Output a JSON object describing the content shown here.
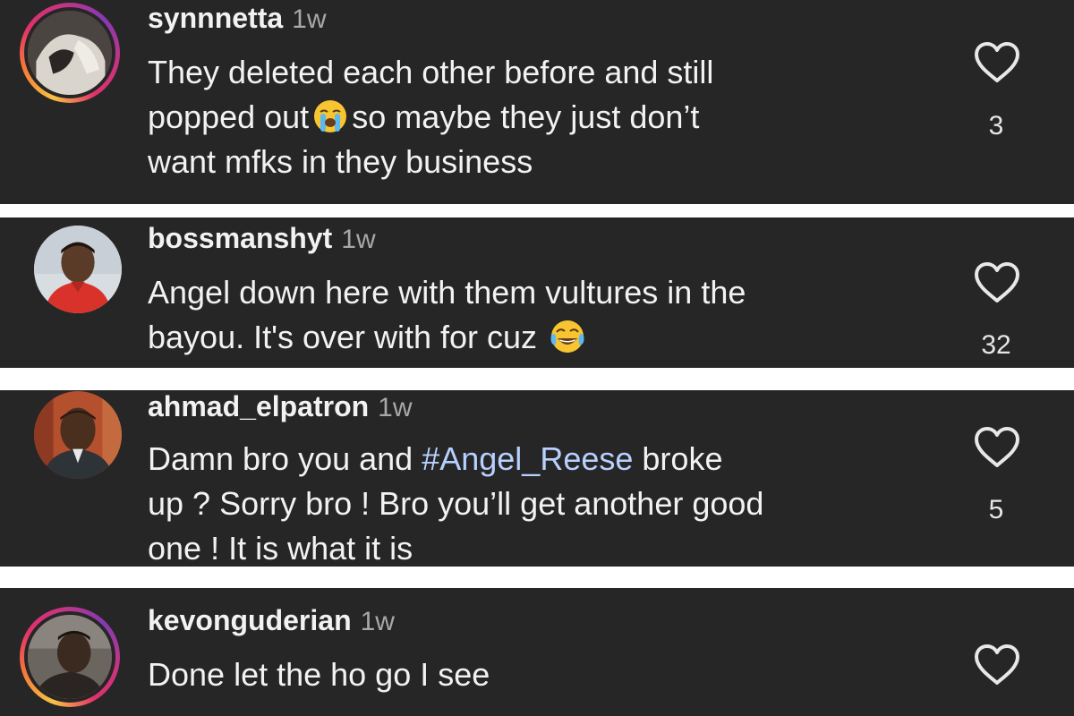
{
  "comments": [
    {
      "username": "synnnetta",
      "time": "1w",
      "avatar": "avatar-story-ring",
      "lines": [
        "They deleted each other before and still",
        "popped out",
        "so maybe they just don’t",
        "want mfks in they business"
      ],
      "emoji": "loudly-crying-face",
      "likes": "3"
    },
    {
      "username": "bossmanshyt",
      "time": "1w",
      "avatar": "avatar-plain",
      "lines": [
        "Angel down here with them vultures in the",
        "bayou. It's over  with for cuz"
      ],
      "emoji": "face-with-tears-of-joy",
      "likes": "32"
    },
    {
      "username": "ahmad_elpatron",
      "time": "1w",
      "avatar": "avatar-plain",
      "lines": [
        "Damn bro you and",
        "#Angel_Reese",
        "broke",
        "up ? Sorry bro ! Bro you’ll get another good",
        "one ! It is what it is"
      ],
      "likes": "5"
    },
    {
      "username": "kevonguderian",
      "time": "1w",
      "avatar": "avatar-story-ring",
      "lines": [
        "Done let the ho go I see"
      ],
      "likes": ""
    }
  ],
  "colors": {
    "background": "#262626",
    "text": "#f2f2f2",
    "muted": "#a8a8a8",
    "hashtag": "#b8d0ff",
    "separator": "#ffffff"
  },
  "icons": [
    "heart-icon",
    "loudly-crying-face-emoji",
    "face-with-tears-of-joy-emoji"
  ]
}
